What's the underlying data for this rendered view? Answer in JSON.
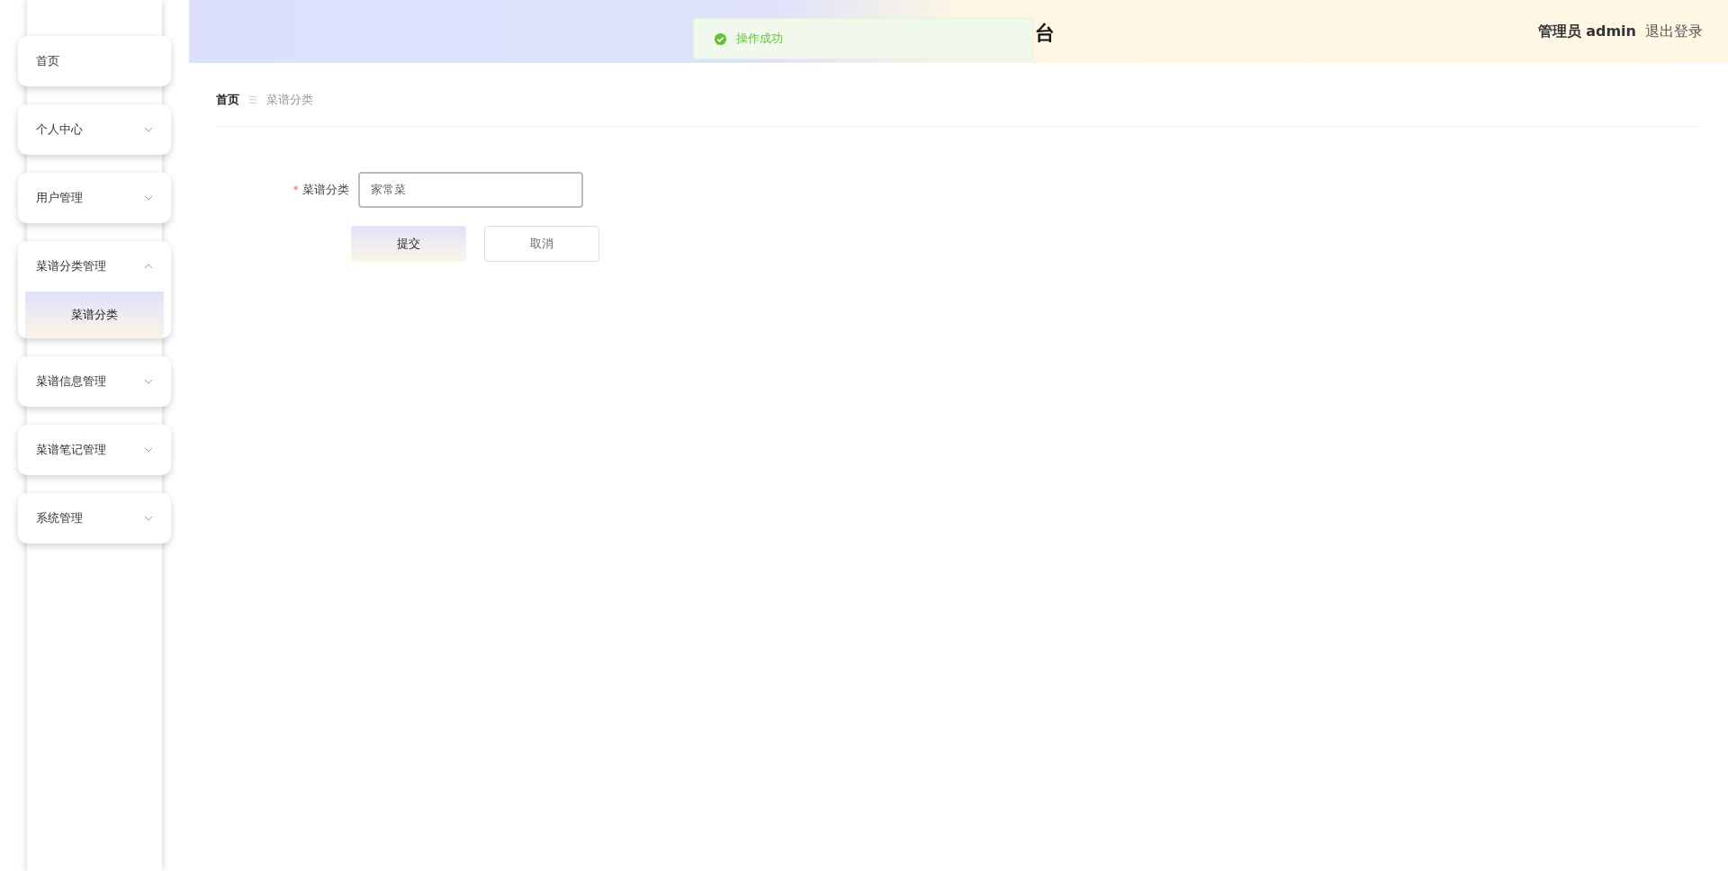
{
  "sidebar": {
    "items": [
      {
        "label": "首页",
        "kind": "link"
      },
      {
        "label": "个人中心",
        "kind": "submenu",
        "expanded": false
      },
      {
        "label": "用户管理",
        "kind": "submenu",
        "expanded": false
      },
      {
        "label": "菜谱分类管理",
        "kind": "submenu",
        "expanded": true,
        "children": [
          {
            "label": "菜谱分类",
            "selected": true
          }
        ]
      },
      {
        "label": "菜谱信息管理",
        "kind": "submenu",
        "expanded": false
      },
      {
        "label": "菜谱笔记管理",
        "kind": "submenu",
        "expanded": false
      },
      {
        "label": "系统管理",
        "kind": "submenu",
        "expanded": false
      }
    ]
  },
  "header": {
    "title": "台",
    "user": "管理员 admin",
    "logout": "退出登录"
  },
  "toast": {
    "message": "操作成功"
  },
  "breadcrumb": {
    "items": [
      "首页",
      "菜谱分类"
    ],
    "separator": "☰"
  },
  "form": {
    "field": {
      "label": "菜谱分类",
      "required_mark": "*",
      "value": "家常菜"
    },
    "buttons": [
      {
        "label": "提交",
        "kind": "primary"
      },
      {
        "label": "取消",
        "kind": "default"
      }
    ]
  }
}
